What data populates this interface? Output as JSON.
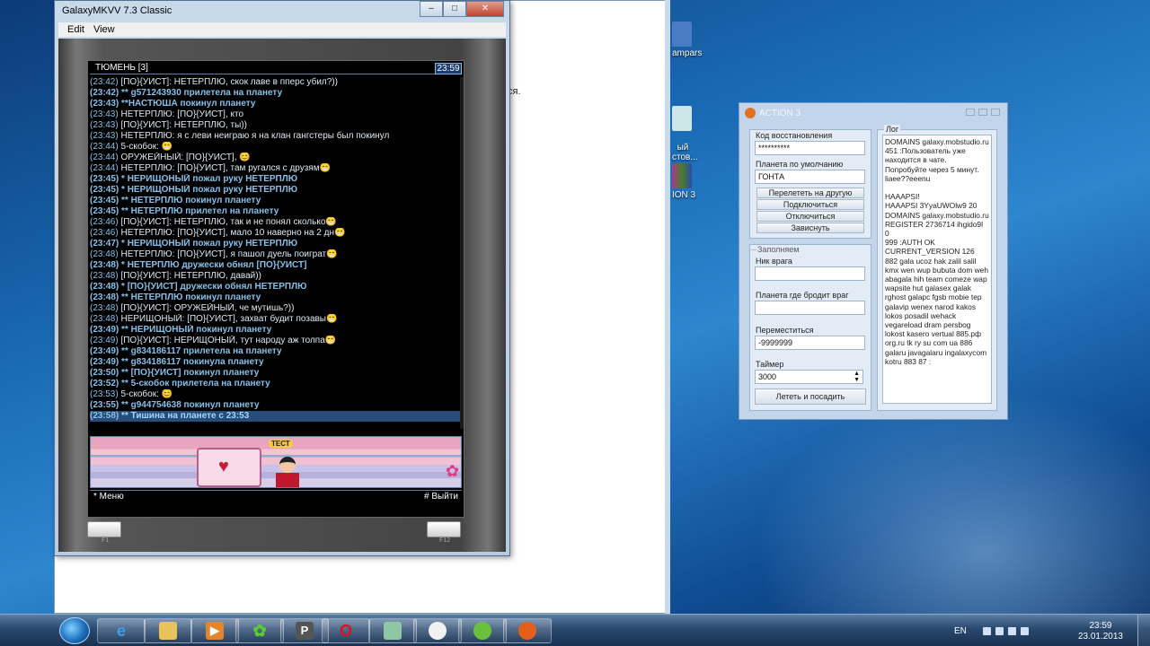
{
  "background_window": {
    "partial_text": "ся."
  },
  "desktop_icons": [
    {
      "label": "ampars"
    },
    {
      "label": "ый\nстов..."
    },
    {
      "label": "ION 3"
    }
  ],
  "galaxy_window": {
    "title": "GalaxyMKVV 7.3 Classic",
    "menu": [
      "Edit",
      "View"
    ],
    "screen": {
      "location": "ТЮМЕНЬ [3]",
      "clock": "23:59",
      "chat": [
        {
          "time": "(23:42)",
          "text": "[ПО}{УИСТ]: НЕТЕРПЛЮ, скок лаве в пперс убил?))",
          "type": "msg"
        },
        {
          "time": "(23:42)",
          "text": "** g571243930 прилетела на планету",
          "type": "sys"
        },
        {
          "time": "(23:43)",
          "text": "**НАСТЮША покинул планету",
          "type": "sys"
        },
        {
          "time": "(23:43)",
          "text": "НЕТЕРПЛЮ: [ПО}{УИСТ], кто",
          "type": "msg"
        },
        {
          "time": "(23:43)",
          "text": "[ПО}{УИСТ]: НЕТЕРПЛЮ, ты))",
          "type": "msg"
        },
        {
          "time": "(23:43)",
          "text": "НЕТЕРПЛЮ: я с леви неиграю я на клан гангстеры был покинул",
          "type": "msg"
        },
        {
          "time": "(23:44)",
          "text": "5-скобок: 😁",
          "type": "msg"
        },
        {
          "time": "(23:44)",
          "text": "ОРУЖЕЙНЫЙ: [ПО}{УИСТ], 😊",
          "type": "msg"
        },
        {
          "time": "(23:44)",
          "text": "НЕТЕРПЛЮ: [ПО}{УИСТ], там ругался с друзям😁",
          "type": "msg"
        },
        {
          "time": "(23:45)",
          "text": "* НЕРИЩОНЫЙ пожал руку НЕТЕРПЛЮ",
          "type": "sys"
        },
        {
          "time": "(23:45)",
          "text": "* НЕРИЩОНЫЙ пожал руку НЕТЕРПЛЮ",
          "type": "sys"
        },
        {
          "time": "(23:45)",
          "text": "** НЕТЕРПЛЮ покинул планету",
          "type": "sys"
        },
        {
          "time": "(23:45)",
          "text": "** НЕТЕРПЛЮ прилетел на планету",
          "type": "sys"
        },
        {
          "time": "(23:46)",
          "text": "[ПО}{УИСТ]: НЕТЕРПЛЮ, так и не понял сколько😁",
          "type": "msg"
        },
        {
          "time": "(23:46)",
          "text": "НЕТЕРПЛЮ: [ПО}{УИСТ], мало 10 наверно на 2 дн😁",
          "type": "msg"
        },
        {
          "time": "(23:47)",
          "text": "* НЕРИЩОНЫЙ пожал руку НЕТЕРПЛЮ",
          "type": "sys"
        },
        {
          "time": "(23:48)",
          "text": "НЕТЕРПЛЮ: [ПО}{УИСТ], я пашол дуель поиграт😁",
          "type": "msg"
        },
        {
          "time": "(23:48)",
          "text": "* НЕТЕРПЛЮ дружески обнял [ПО}{УИСТ]",
          "type": "sys"
        },
        {
          "time": "(23:48)",
          "text": "[ПО}{УИСТ]: НЕТЕРПЛЮ, давай))",
          "type": "msg"
        },
        {
          "time": "(23:48)",
          "text": "* [ПО}{УИСТ] дружески обнял НЕТЕРПЛЮ",
          "type": "sys"
        },
        {
          "time": "(23:48)",
          "text": "** НЕТЕРПЛЮ покинул планету",
          "type": "sys"
        },
        {
          "time": "(23:48)",
          "text": "[ПО}{УИСТ]: ОРУЖЕЙНЫЙ, че мутишь?))",
          "type": "msg"
        },
        {
          "time": "(23:48)",
          "text": "НЕРИЩОНЫЙ: [ПО}{УИСТ], захват будит позавы😁",
          "type": "msg"
        },
        {
          "time": "(23:49)",
          "text": "** НЕРИЩОНЫЙ покинул планету",
          "type": "sys"
        },
        {
          "time": "(23:49)",
          "text": "[ПО}{УИСТ]: НЕРИЩОНЫЙ, тут народу аж толпа😁",
          "type": "msg"
        },
        {
          "time": "(23:49)",
          "text": "** g834186117 прилетела на планету",
          "type": "sys"
        },
        {
          "time": "(23:49)",
          "text": "** g834186117 покинула планету",
          "type": "sys"
        },
        {
          "time": "(23:50)",
          "text": "** [ПО}{УИСТ] покинул планету",
          "type": "sys"
        },
        {
          "time": "(23:52)",
          "text": "** 5-скобок прилетела на планету",
          "type": "sys"
        },
        {
          "time": "(23:53)",
          "text": "5-скобок: 😊",
          "type": "msg"
        },
        {
          "time": "(23:55)",
          "text": "** g944754638 покинул планету",
          "type": "sys"
        },
        {
          "time": "(23:58)",
          "text": "** Тишина на планете с 23:53",
          "type": "sel"
        }
      ],
      "avatar_tag": "ТЕСТ",
      "soft_left": "* Меню",
      "soft_right": "# Выйти",
      "key_left": "F1",
      "key_right": "F12"
    }
  },
  "action_window": {
    "title": "ACTION 3",
    "recovery_label": "Код восстановления",
    "recovery_value": "**********",
    "planet_label": "Планета по умолчанию",
    "planet_value": "ГОНТА",
    "btn_fly": "Перелететь на другую",
    "btn_connect": "Подключиться",
    "btn_disconnect": "Отключиться",
    "btn_hang": "Зависнуть",
    "fill_group": "Заполняем",
    "enemy_nick_label": "Ник врага",
    "enemy_nick_value": "",
    "enemy_planet_label": "Планета где бродит враг",
    "enemy_planet_value": "",
    "move_label": "Переместиться",
    "move_value": "-9999999",
    "timer_label": "Таймер",
    "timer_value": "3000",
    "btn_fly_land": "Лететь и посадить",
    "log_label": "Лог",
    "log_lines": [
      "DOMAINS galaxy.mobstudio.ru",
      "451 :Пользователь уже",
      "находится в чате.",
      "Попробуйте через 5 минут.",
      "liaee??eeenu",
      "",
      "HAAAPSI!",
      "HAAAPSI 3YyaUWOlw9 20",
      "DOMAINS galaxy.mobstudio.ru",
      "REGISTER 2736714 ihgido9l",
      "0",
      "999 :AUTH OK",
      "CURRENT_VERSION 126",
      "882 gala ucoz hak zalil salil",
      "kmx wen wup bubuta dom weh",
      "abagala hih team comeze wap",
      "wapsite hut galasex galak",
      "rghost galapc fgsb mobie tep",
      "galavip wenex narod kakos",
      "lokos posadil wehack",
      "vegareload dram persbog",
      "lokost kasero vertual 885.рф",
      "org.ru tk ry su com ua 886",
      "galaru javagalaru ingalaxycom",
      "kotru 883 87 :"
    ]
  },
  "taskbar": {
    "buttons": [
      "ie",
      "folder",
      "media",
      "icq",
      "P",
      "opera",
      "app",
      "alien-mask",
      "alien",
      "devil"
    ],
    "lang": "EN",
    "time": "23:59",
    "date": "23.01.2013"
  }
}
